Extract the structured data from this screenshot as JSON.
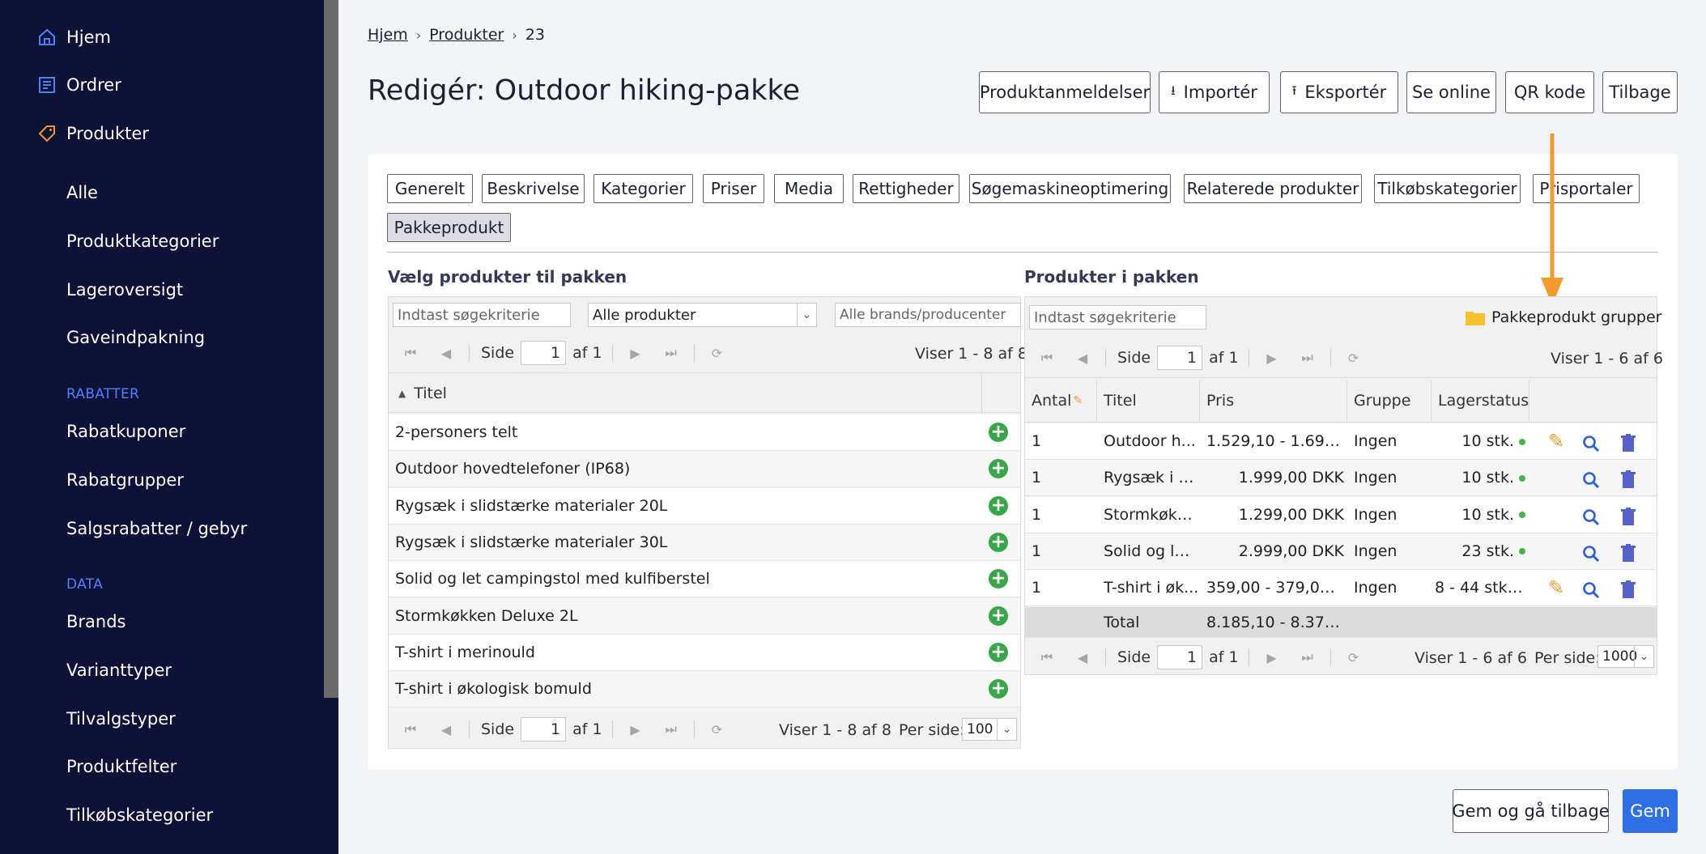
{
  "sidebar": {
    "top_items": [
      {
        "label": "Hjem",
        "icon": "home-icon"
      },
      {
        "label": "Ordrer",
        "icon": "orders-icon"
      },
      {
        "label": "Produkter",
        "icon": "tag-icon"
      }
    ],
    "product_items": [
      "Alle",
      "Produktkategorier",
      "Lageroversigt",
      "Gaveindpakning"
    ],
    "sections": [
      {
        "title": "RABATTER",
        "items": [
          "Rabatkuponer",
          "Rabatgrupper",
          "Salgsrabatter / gebyr"
        ]
      },
      {
        "title": "DATA",
        "items": [
          "Brands",
          "Varianttyper",
          "Tilvalgstyper",
          "Produktfelter",
          "Tilkøbskategorier"
        ]
      }
    ]
  },
  "breadcrumb": {
    "home": "Hjem",
    "products": "Produkter",
    "current": "23"
  },
  "page_title": "Redigér: Outdoor hiking-pakke",
  "toolbar": {
    "reviews": "Produktanmeldelser",
    "import": "Importér",
    "export": "Eksportér",
    "online": "Se online",
    "qr": "QR kode",
    "back": "Tilbage"
  },
  "tabs": [
    "Generelt",
    "Beskrivelse",
    "Kategorier",
    "Priser",
    "Media",
    "Rettigheder",
    "Søgemaskineoptimering",
    "Relaterede produkter",
    "Tilkøbskategorier",
    "Prisportaler",
    "Pakkeprodukt"
  ],
  "active_tab": "Pakkeprodukt",
  "left": {
    "title": "Vælg produkter til pakken",
    "search_placeholder": "Indtast søgekriterie",
    "filter_value": "Alle produkter",
    "brand_placeholder": "Alle brands/producenter",
    "pager_label": "Side",
    "page": "1",
    "of": "af 1",
    "showing": "Viser 1 - 8 af 8",
    "per_page_label": "Per side:",
    "per_page": "100",
    "column_title": "Titel",
    "rows": [
      "2-personers telt",
      "Outdoor hovedtelefoner (IP68)",
      "Rygsæk i slidstærke materialer 20L",
      "Rygsæk i slidstærke materialer 30L",
      "Solid og let campingstol med kulfiberstel",
      "Stormkøkken Deluxe 2L",
      "T-shirt i merinould",
      "T-shirt i økologisk bomuld"
    ]
  },
  "right": {
    "title": "Produkter i pakken",
    "search_placeholder": "Indtast søgekriterie",
    "groups_label": "Pakkeprodukt grupper",
    "pager_label": "Side",
    "page": "1",
    "of": "af 1",
    "showing": "Viser 1 - 6 af 6",
    "per_page_label": "Per side:",
    "per_page": "1000",
    "columns": {
      "qty": "Antal",
      "title": "Titel",
      "price": "Pris",
      "group": "Gruppe",
      "stock": "Lagerstatus"
    },
    "rows": [
      {
        "qty": "1",
        "title": "Outdoor h...",
        "price": "1.529,10 - 1.699,0...",
        "group": "Ingen",
        "stock": "10 stk.",
        "edit": true
      },
      {
        "qty": "1",
        "title": "Rygsæk i sl...",
        "price": "1.999,00 DKK",
        "group": "Ingen",
        "stock": "10 stk.",
        "edit": false
      },
      {
        "qty": "1",
        "title": "Stormkøkk...",
        "price": "1.299,00 DKK",
        "group": "Ingen",
        "stock": "10 stk.",
        "edit": false
      },
      {
        "qty": "1",
        "title": "Solid og let...",
        "price": "2.999,00 DKK",
        "group": "Ingen",
        "stock": "23 stk.",
        "edit": false
      },
      {
        "qty": "1",
        "title": "T-shirt i øk...",
        "price": "359,00 - 379,00 D...",
        "group": "Ingen",
        "stock": "8 - 44 stk....",
        "edit": true
      }
    ],
    "total_label": "Total",
    "total_value": "8.185,10 - 8.375,0..."
  },
  "footer": {
    "save_back": "Gem og gå tilbage",
    "save": "Gem"
  },
  "colors": {
    "sidebar": "#0d1236",
    "accent": "#2f6fe4",
    "arrow": "#f29a2e",
    "plus": "#3aa64a",
    "trash": "#5561c9"
  }
}
